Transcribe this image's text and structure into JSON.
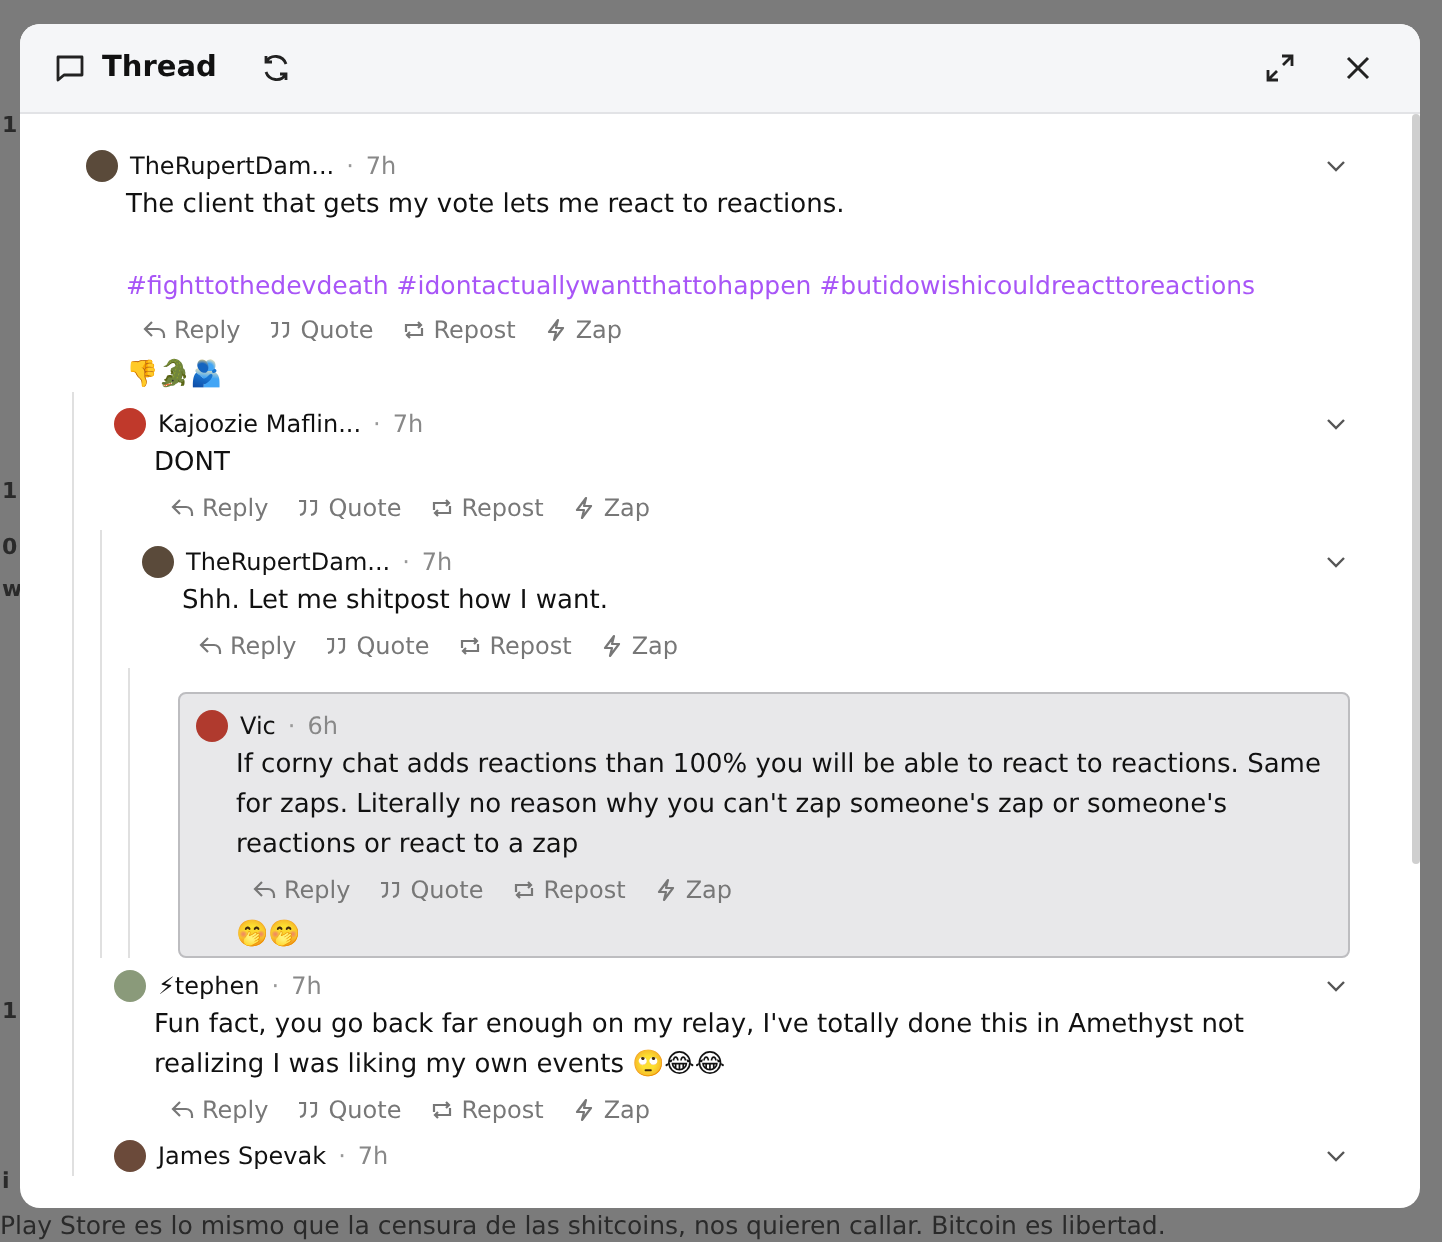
{
  "backdrop": {
    "fragments": [
      "1",
      "1",
      "0",
      "w",
      "1",
      "i"
    ],
    "footer_text": "Play Store es lo mismo que la censura de las shitcoins, nos quieren callar. Bitcoin es libertad."
  },
  "window": {
    "title": "Thread"
  },
  "posts": [
    {
      "author": "TheRupertDam...",
      "separator": "·",
      "time": "7h",
      "color": "#5a4a3a",
      "highlighted": false,
      "text": "The client that gets my vote lets me react to reactions.",
      "hashtags": [
        "#fighttothedevdeath",
        "#idontactuallywantthattohappen",
        "#butidowishicouldreacttoreactions"
      ],
      "actions": [
        {
          "kind": "reply",
          "label": "Reply"
        },
        {
          "kind": "quote",
          "label": "Quote"
        },
        {
          "kind": "repost",
          "label": "Repost"
        },
        {
          "kind": "zap",
          "label": "Zap"
        }
      ],
      "reactions": "👎🐊🫂",
      "children": [
        {
          "author": "Kajoozie Maflin...",
          "separator": "·",
          "time": "7h",
          "color": "#c0392b",
          "highlighted": false,
          "text": "DONT",
          "actions": [
            {
              "kind": "reply",
              "label": "Reply"
            },
            {
              "kind": "quote",
              "label": "Quote"
            },
            {
              "kind": "repost",
              "label": "Repost"
            },
            {
              "kind": "zap",
              "label": "Zap"
            }
          ],
          "children": [
            {
              "author": "TheRupertDam...",
              "separator": "·",
              "time": "7h",
              "color": "#5a4a3a",
              "highlighted": false,
              "text": "Shh. Let me shitpost how I want.",
              "actions": [
                {
                  "kind": "reply",
                  "label": "Reply"
                },
                {
                  "kind": "quote",
                  "label": "Quote"
                },
                {
                  "kind": "repost",
                  "label": "Repost"
                },
                {
                  "kind": "zap",
                  "label": "Zap"
                }
              ],
              "children": [
                {
                  "author": "Vic",
                  "separator": "·",
                  "time": "6h",
                  "color": "#b03a2e",
                  "highlighted": true,
                  "text": "If corny chat adds reactions than 100% you will be able to react to reactions. Same for zaps. Literally no reason why you can't zap someone's zap or someone's reactions or react to a zap",
                  "actions": [
                    {
                      "kind": "reply",
                      "label": "Reply"
                    },
                    {
                      "kind": "quote",
                      "label": "Quote"
                    },
                    {
                      "kind": "repost",
                      "label": "Repost"
                    },
                    {
                      "kind": "zap",
                      "label": "Zap"
                    }
                  ],
                  "reactions": "🤭🤭"
                }
              ]
            }
          ]
        },
        {
          "author": "⚡tephen",
          "separator": "·",
          "time": "7h",
          "color": "#8a9a7a",
          "highlighted": false,
          "text": "Fun fact, you go back far enough on my relay, I've totally done this in Amethyst not realizing I was liking my own events 🙄😂😂",
          "actions": [
            {
              "kind": "reply",
              "label": "Reply"
            },
            {
              "kind": "quote",
              "label": "Quote"
            },
            {
              "kind": "repost",
              "label": "Repost"
            },
            {
              "kind": "zap",
              "label": "Zap"
            }
          ]
        },
        {
          "author": "James Spevak",
          "separator": "·",
          "time": "7h",
          "color": "#6b4a3a",
          "highlighted": false
        }
      ]
    }
  ]
}
